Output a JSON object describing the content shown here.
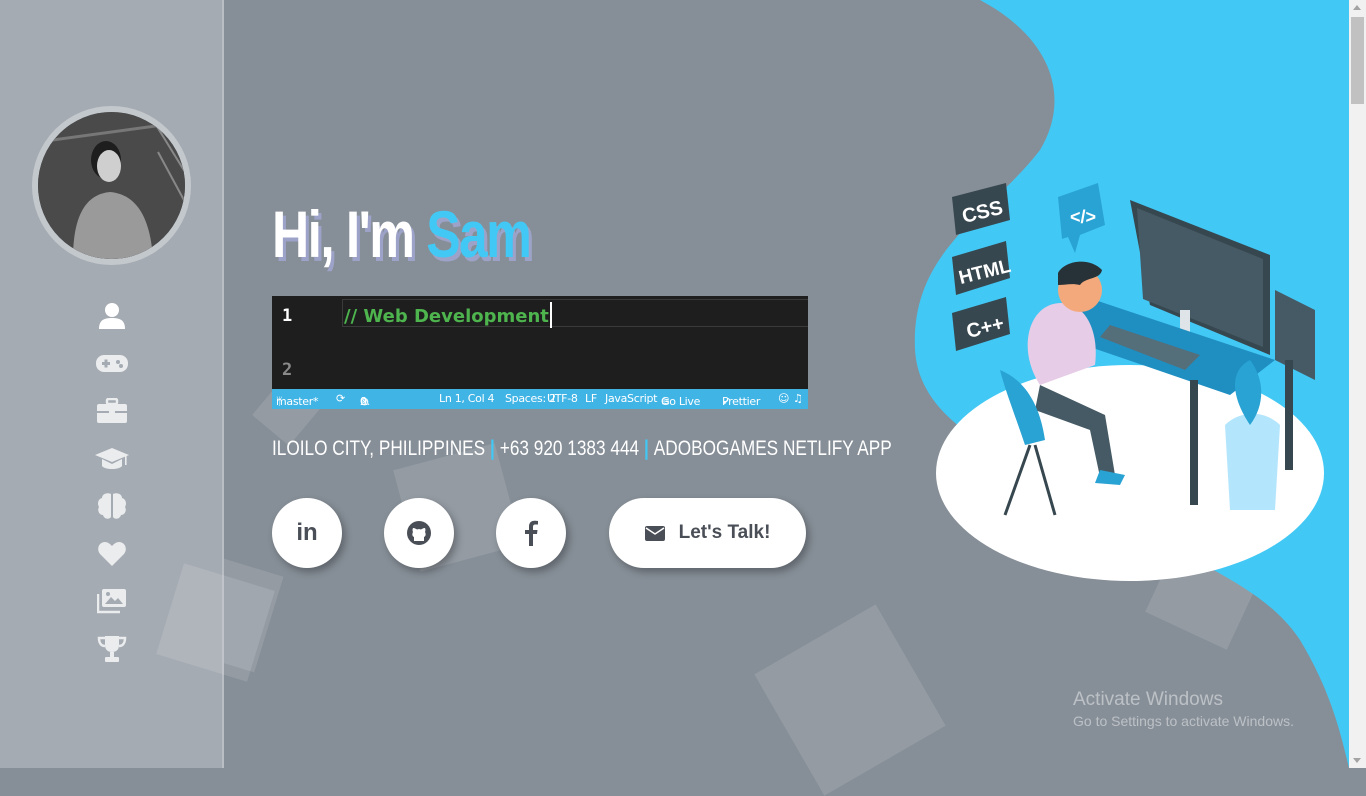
{
  "hero": {
    "greeting": "Hi, I'm",
    "name": "Sam"
  },
  "editor": {
    "line_numbers": [
      "1",
      "2"
    ],
    "code_line": "//  Web Development",
    "status": {
      "branch": "master*",
      "errors": "0",
      "warnings": "0",
      "position": "Ln 1, Col 4",
      "spaces": "Spaces: 2",
      "encoding": "UTF-8",
      "eol": "LF",
      "language": "JavaScript",
      "go_live": "Go Live",
      "prettier": "Prettier"
    }
  },
  "contact": {
    "location": "ILOILO CITY, PHILIPPINES",
    "separator": "|",
    "phone": "+63 920 1383 444",
    "site": "ADOBOGAMES NETLIFY APP"
  },
  "social": {
    "linkedin": "in",
    "talk_label": "Let's Talk!"
  },
  "sidebar": {
    "nav": [
      {
        "icon": "user-icon",
        "active": true
      },
      {
        "icon": "gamepad-icon"
      },
      {
        "icon": "briefcase-icon"
      },
      {
        "icon": "graduation-cap-icon"
      },
      {
        "icon": "brain-icon"
      },
      {
        "icon": "heart-icon"
      },
      {
        "icon": "images-icon"
      },
      {
        "icon": "trophy-icon"
      }
    ]
  },
  "illustration": {
    "tags": [
      "CSS",
      "HTML",
      "C++",
      "</>"
    ]
  },
  "watermark": {
    "title": "Activate Windows",
    "subtitle": "Go to Settings to activate Windows."
  },
  "colors": {
    "accent": "#42c8f4",
    "background": "#868e97",
    "sidebar": "#a5abb3",
    "code_comment": "#4eb44e",
    "status_bar": "#41b4e6"
  }
}
